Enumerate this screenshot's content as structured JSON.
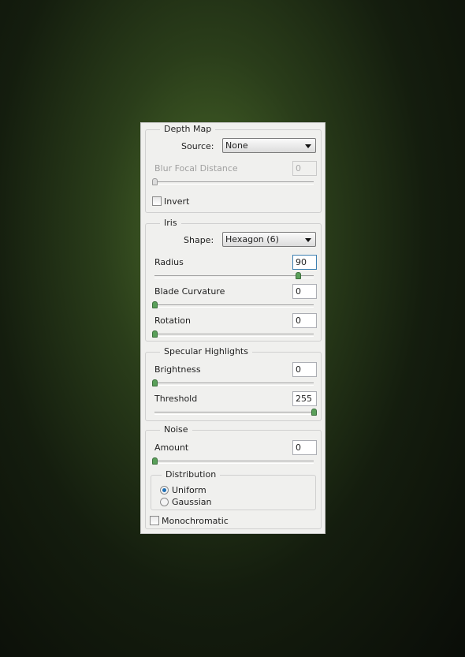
{
  "depth_map": {
    "title": "Depth Map",
    "source_label": "Source:",
    "source_value": "None",
    "blur_focal_label": "Blur Focal Distance",
    "blur_focal_value": "0",
    "blur_focal_fraction": 0,
    "invert_label": "Invert",
    "invert_checked": false
  },
  "iris": {
    "title": "Iris",
    "shape_label": "Shape:",
    "shape_value": "Hexagon (6)",
    "radius_label": "Radius",
    "radius_value": "90",
    "radius_fraction": 0.9,
    "blade_label": "Blade Curvature",
    "blade_value": "0",
    "blade_fraction": 0,
    "rotation_label": "Rotation",
    "rotation_value": "0",
    "rotation_fraction": 0
  },
  "specular": {
    "title": "Specular Highlights",
    "brightness_label": "Brightness",
    "brightness_value": "0",
    "brightness_fraction": 0,
    "threshold_label": "Threshold",
    "threshold_value": "255",
    "threshold_fraction": 1
  },
  "noise": {
    "title": "Noise",
    "amount_label": "Amount",
    "amount_value": "0",
    "amount_fraction": 0,
    "distribution_title": "Distribution",
    "uniform_label": "Uniform",
    "gaussian_label": "Gaussian",
    "selected": "Uniform",
    "monochromatic_label": "Monochromatic",
    "monochromatic_checked": false
  },
  "colors": {
    "slider_thumb": "#5aa05a",
    "radio_selected": "#1f6fb5",
    "panel": "#f0f0ee"
  }
}
